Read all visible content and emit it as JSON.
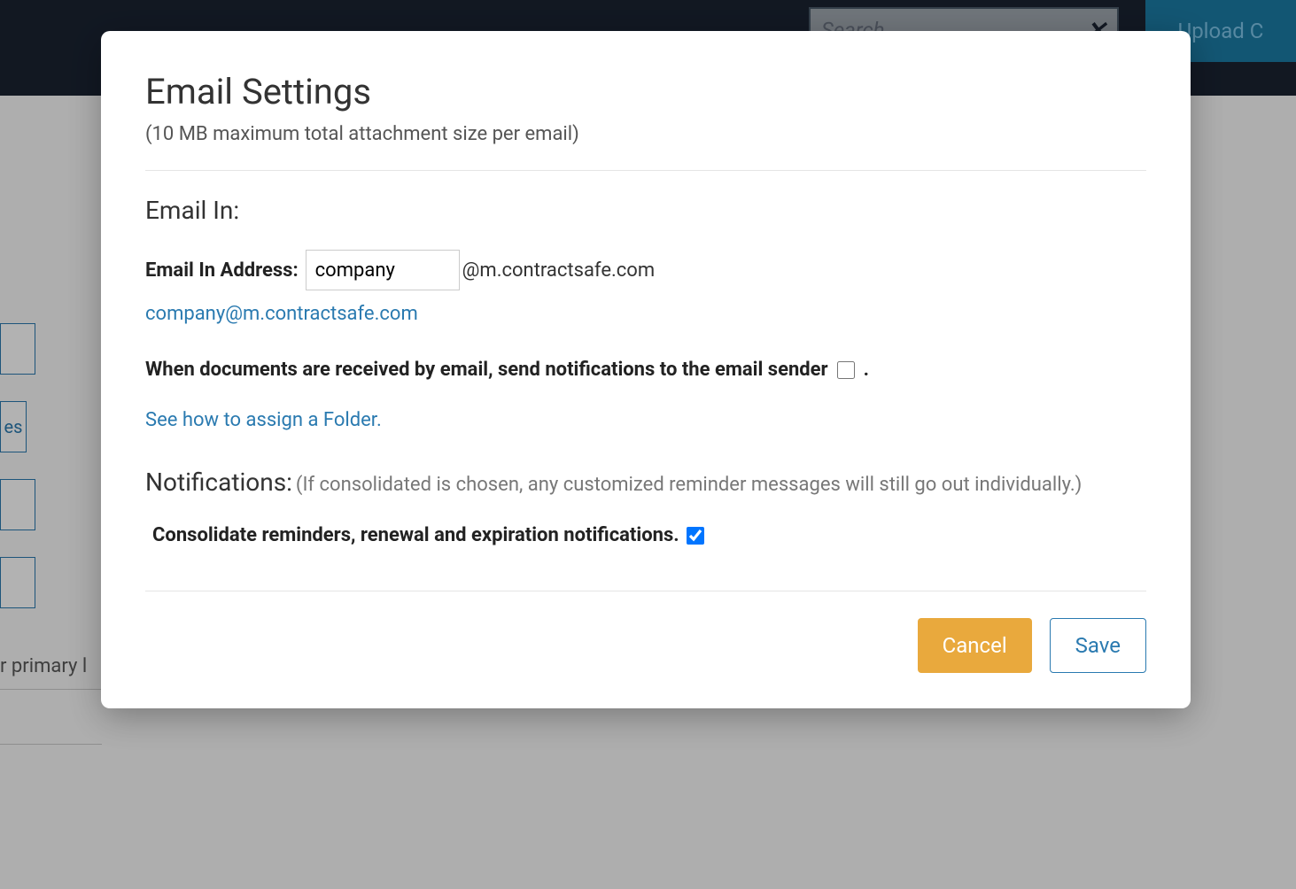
{
  "background": {
    "search_placeholder": "Search",
    "upload_button": "Upload C",
    "sidebar_text": "es",
    "content_text": "r primary l"
  },
  "modal": {
    "title": "Email Settings",
    "subtitle": "(10 MB maximum total attachment size per email)",
    "email_in": {
      "heading": "Email In:",
      "address_label": "Email In Address:",
      "address_value": "company",
      "address_suffix": "@m.contractsafe.com",
      "full_email_link": "company@m.contractsafe.com",
      "notification_text": "When documents are received by email, send notifications to the email sender",
      "notification_suffix": ".",
      "notify_sender_checked": false,
      "folder_help_link": "See how to assign a Folder."
    },
    "notifications": {
      "heading": "Notifications:",
      "subtext": "(If consolidated is chosen, any customized reminder messages will still go out individually.)",
      "consolidate_label": "Consolidate reminders, renewal and expiration notifications.",
      "consolidate_checked": true
    },
    "buttons": {
      "cancel": "Cancel",
      "save": "Save"
    }
  }
}
